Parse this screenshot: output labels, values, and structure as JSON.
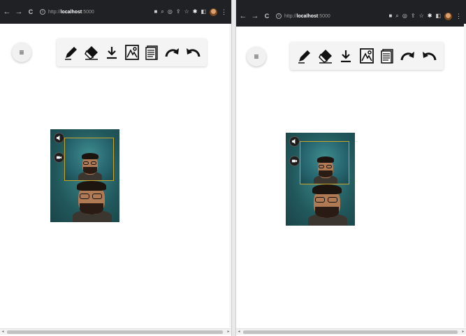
{
  "panes": [
    {
      "url": {
        "scheme": "http://",
        "host": "localhost",
        "port": ":5000"
      }
    },
    {
      "url": {
        "scheme": "http://",
        "host": "localhost",
        "port": ":5000"
      }
    }
  ],
  "toolbar": {
    "tools": [
      "pencil-icon",
      "eraser-icon",
      "download-icon",
      "image-icon",
      "notes-icon",
      "redo-icon",
      "undo-icon"
    ]
  },
  "menu": {
    "label": "≡"
  },
  "nav": {
    "back": "←",
    "forward": "→",
    "reload": "C"
  },
  "colors": {
    "browser_chrome": "#202124",
    "toolbar_bg": "#f4f4f4",
    "video_bg": "#2a6b6e",
    "pip_border": "#c9a52a",
    "page_bg": "#ffffff"
  }
}
